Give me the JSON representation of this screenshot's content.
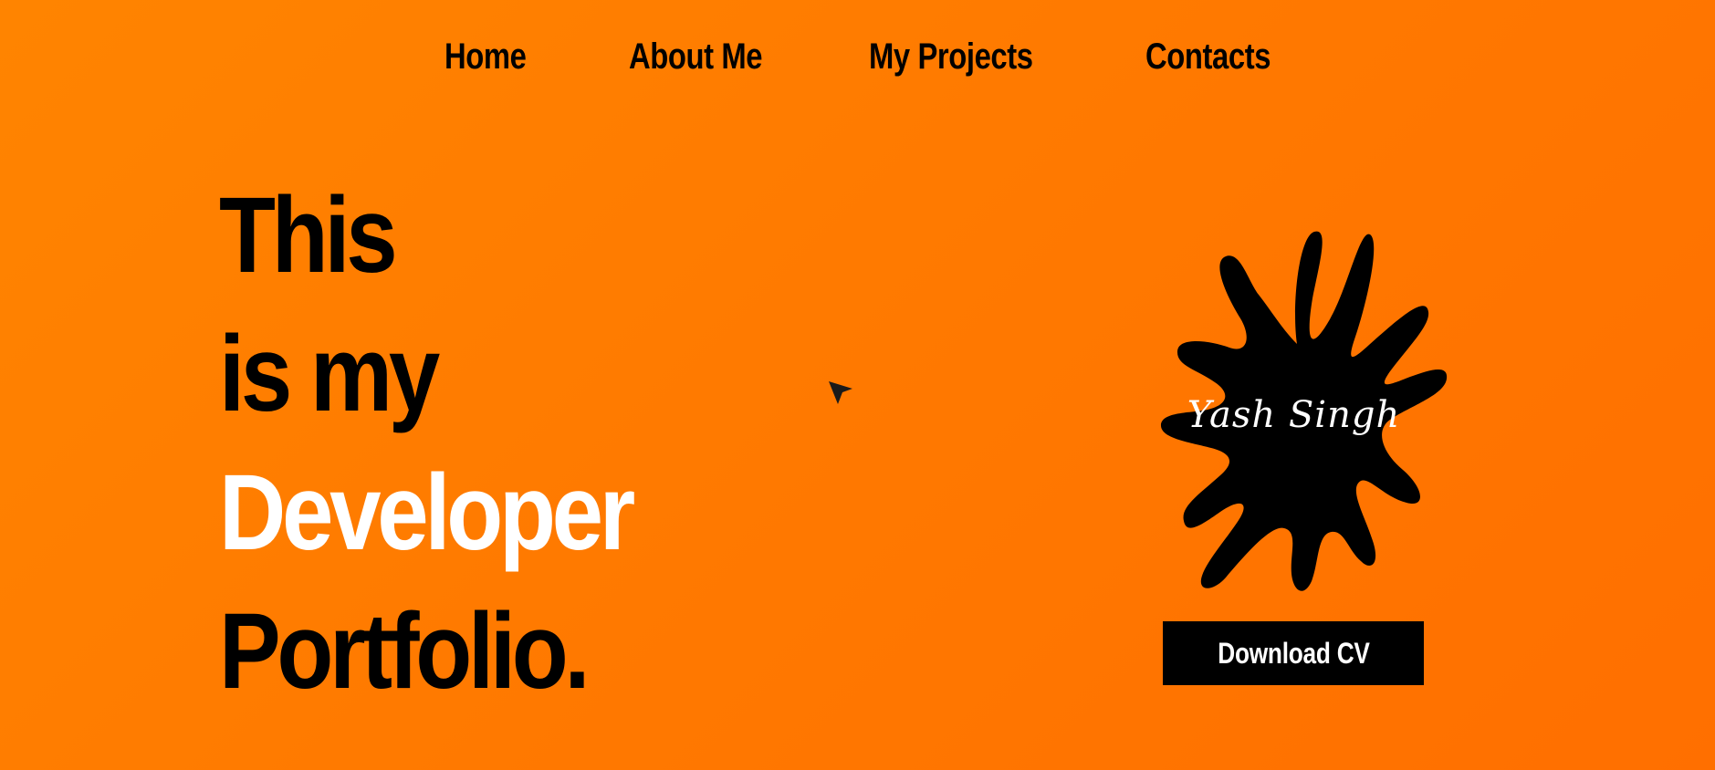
{
  "nav": {
    "items": [
      {
        "label": "Home"
      },
      {
        "label": "About Me"
      },
      {
        "label": "My Projects"
      },
      {
        "label": "Contacts"
      }
    ]
  },
  "hero": {
    "lines": [
      {
        "text": "This"
      },
      {
        "text": "is my"
      },
      {
        "text": "Developer"
      },
      {
        "text": "Portfolio."
      }
    ]
  },
  "profile": {
    "name": "Yash Singh",
    "shape": "ink-splat"
  },
  "actions": {
    "download_cv_label": "Download CV"
  },
  "icons": {
    "cursor": "mouse-pointer-icon"
  },
  "colors": {
    "background_start": "#ff8400",
    "background_end": "#ff6f00",
    "text_primary": "#000000",
    "text_accent": "#ffffff",
    "button_bg": "#000000",
    "button_text": "#ffffff"
  }
}
